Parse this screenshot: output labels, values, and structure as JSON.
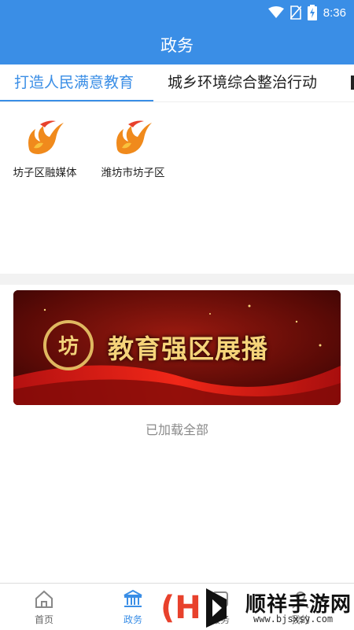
{
  "statusbar": {
    "time": "8:36"
  },
  "appbar": {
    "title": "政务"
  },
  "tabs": [
    {
      "label": "打造人民满意教育",
      "active": true
    },
    {
      "label": "城乡环境综合整治行动",
      "active": false
    }
  ],
  "orgs": [
    {
      "label": "坊子区融媒体",
      "icon": "flame-logo-icon"
    },
    {
      "label": "潍坊市坊子区",
      "icon": "flame-logo-icon"
    }
  ],
  "banner": {
    "text": "教育强区展播"
  },
  "list_status": "已加载全部",
  "bottom_nav": [
    {
      "label": "首页",
      "icon": "home-icon",
      "active": false
    },
    {
      "label": "政务",
      "icon": "government-icon",
      "active": true
    },
    {
      "label": "服务",
      "icon": "service-icon",
      "active": false
    },
    {
      "label": "我的",
      "icon": "profile-icon",
      "active": false
    }
  ],
  "watermark": {
    "brand": "顺祥手游网",
    "url": "www.bjsxsy.com"
  },
  "colors": {
    "primary": "#3a8ee6",
    "muted_text": "#8a8a8a",
    "logo_orange": "#f08a1c",
    "logo_red": "#e8412c",
    "banner_gold": "#f6d47a"
  }
}
